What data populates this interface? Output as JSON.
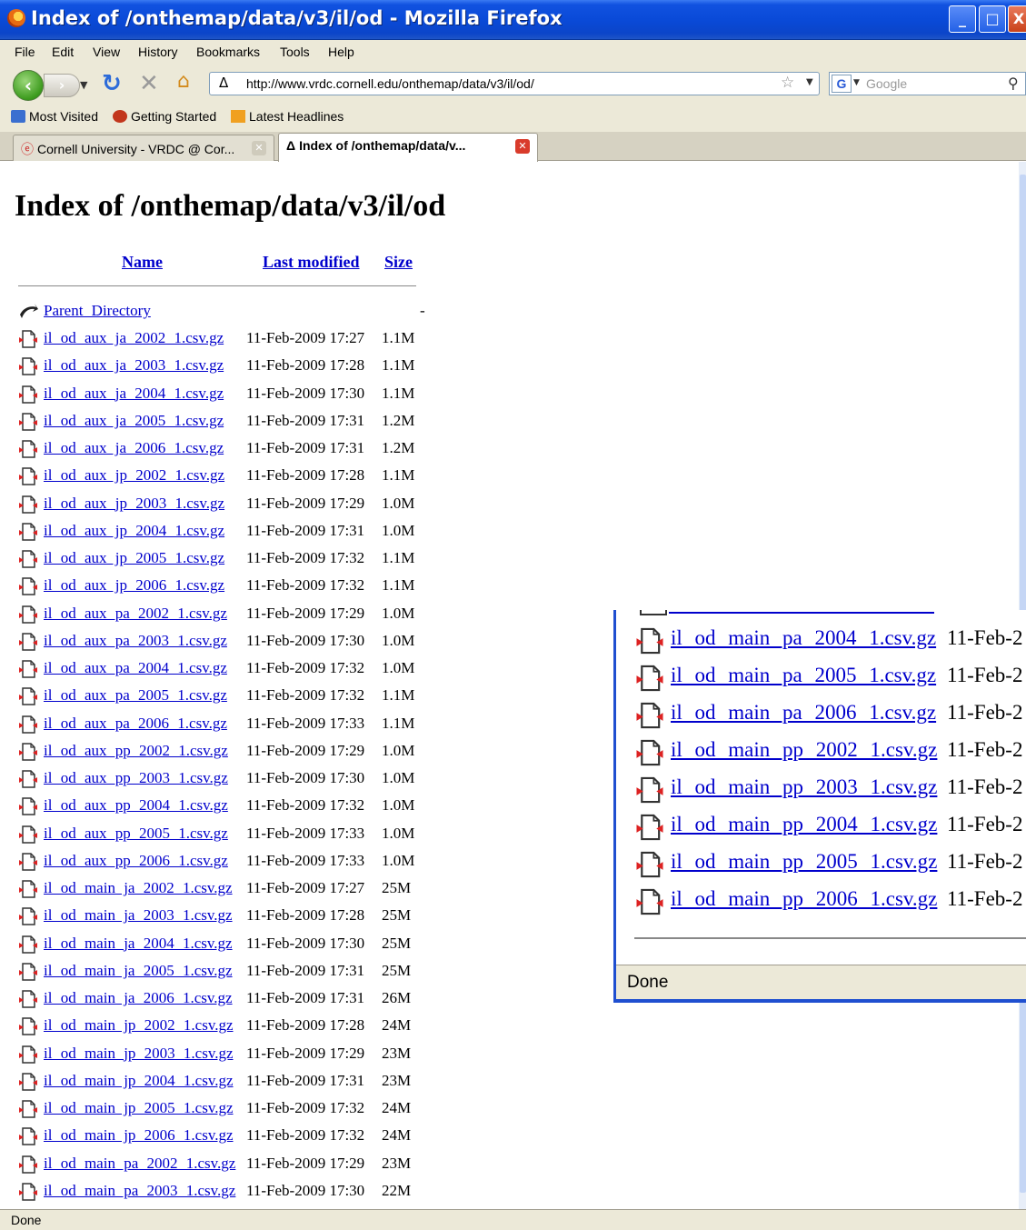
{
  "window": {
    "title": "Index of /onthemap/data/v3/il/od - Mozilla Firefox",
    "minimize": "_",
    "maximize": "□",
    "close": "X"
  },
  "menu": [
    "File",
    "Edit",
    "View",
    "History",
    "Bookmarks",
    "Tools",
    "Help"
  ],
  "nav": {
    "url": "http://www.vrdc.cornell.edu/onthemap/data/v3/il/od/",
    "search_placeholder": "Google",
    "search_engine_letter": "G"
  },
  "bookmarks": [
    "Most Visited",
    "Getting Started",
    "Latest Headlines"
  ],
  "tabs": [
    {
      "label": "Cornell University - VRDC @ Cor...",
      "active": false
    },
    {
      "label": "Index of /onthemap/data/v...",
      "active": true
    }
  ],
  "page": {
    "title": "Index of /onthemap/data/v3/il/od",
    "columns": {
      "name": "Name",
      "modified": "Last modified",
      "size": "Size"
    },
    "parent": {
      "name": "Parent Directory",
      "size": "-"
    },
    "files": [
      {
        "name": "il_od_aux_ja_2002_1.csv.gz",
        "modified": "11-Feb-2009 17:27",
        "size": "1.1M"
      },
      {
        "name": "il_od_aux_ja_2003_1.csv.gz",
        "modified": "11-Feb-2009 17:28",
        "size": "1.1M"
      },
      {
        "name": "il_od_aux_ja_2004_1.csv.gz",
        "modified": "11-Feb-2009 17:30",
        "size": "1.1M"
      },
      {
        "name": "il_od_aux_ja_2005_1.csv.gz",
        "modified": "11-Feb-2009 17:31",
        "size": "1.2M"
      },
      {
        "name": "il_od_aux_ja_2006_1.csv.gz",
        "modified": "11-Feb-2009 17:31",
        "size": "1.2M"
      },
      {
        "name": "il_od_aux_jp_2002_1.csv.gz",
        "modified": "11-Feb-2009 17:28",
        "size": "1.1M"
      },
      {
        "name": "il_od_aux_jp_2003_1.csv.gz",
        "modified": "11-Feb-2009 17:29",
        "size": "1.0M"
      },
      {
        "name": "il_od_aux_jp_2004_1.csv.gz",
        "modified": "11-Feb-2009 17:31",
        "size": "1.0M"
      },
      {
        "name": "il_od_aux_jp_2005_1.csv.gz",
        "modified": "11-Feb-2009 17:32",
        "size": "1.1M"
      },
      {
        "name": "il_od_aux_jp_2006_1.csv.gz",
        "modified": "11-Feb-2009 17:32",
        "size": "1.1M"
      },
      {
        "name": "il_od_aux_pa_2002_1.csv.gz",
        "modified": "11-Feb-2009 17:29",
        "size": "1.0M"
      },
      {
        "name": "il_od_aux_pa_2003_1.csv.gz",
        "modified": "11-Feb-2009 17:30",
        "size": "1.0M"
      },
      {
        "name": "il_od_aux_pa_2004_1.csv.gz",
        "modified": "11-Feb-2009 17:32",
        "size": "1.0M"
      },
      {
        "name": "il_od_aux_pa_2005_1.csv.gz",
        "modified": "11-Feb-2009 17:32",
        "size": "1.1M"
      },
      {
        "name": "il_od_aux_pa_2006_1.csv.gz",
        "modified": "11-Feb-2009 17:33",
        "size": "1.1M"
      },
      {
        "name": "il_od_aux_pp_2002_1.csv.gz",
        "modified": "11-Feb-2009 17:29",
        "size": "1.0M"
      },
      {
        "name": "il_od_aux_pp_2003_1.csv.gz",
        "modified": "11-Feb-2009 17:30",
        "size": "1.0M"
      },
      {
        "name": "il_od_aux_pp_2004_1.csv.gz",
        "modified": "11-Feb-2009 17:32",
        "size": "1.0M"
      },
      {
        "name": "il_od_aux_pp_2005_1.csv.gz",
        "modified": "11-Feb-2009 17:33",
        "size": "1.0M"
      },
      {
        "name": "il_od_aux_pp_2006_1.csv.gz",
        "modified": "11-Feb-2009 17:33",
        "size": "1.0M"
      },
      {
        "name": "il_od_main_ja_2002_1.csv.gz",
        "modified": "11-Feb-2009 17:27",
        "size": "25M"
      },
      {
        "name": "il_od_main_ja_2003_1.csv.gz",
        "modified": "11-Feb-2009 17:28",
        "size": "25M"
      },
      {
        "name": "il_od_main_ja_2004_1.csv.gz",
        "modified": "11-Feb-2009 17:30",
        "size": "25M"
      },
      {
        "name": "il_od_main_ja_2005_1.csv.gz",
        "modified": "11-Feb-2009 17:31",
        "size": "25M"
      },
      {
        "name": "il_od_main_ja_2006_1.csv.gz",
        "modified": "11-Feb-2009 17:31",
        "size": "26M"
      },
      {
        "name": "il_od_main_jp_2002_1.csv.gz",
        "modified": "11-Feb-2009 17:28",
        "size": "24M"
      },
      {
        "name": "il_od_main_jp_2003_1.csv.gz",
        "modified": "11-Feb-2009 17:29",
        "size": "23M"
      },
      {
        "name": "il_od_main_jp_2004_1.csv.gz",
        "modified": "11-Feb-2009 17:31",
        "size": "23M"
      },
      {
        "name": "il_od_main_jp_2005_1.csv.gz",
        "modified": "11-Feb-2009 17:32",
        "size": "24M"
      },
      {
        "name": "il_od_main_jp_2006_1.csv.gz",
        "modified": "11-Feb-2009 17:32",
        "size": "24M"
      },
      {
        "name": "il_od_main_pa_2002_1.csv.gz",
        "modified": "11-Feb-2009 17:29",
        "size": "23M"
      },
      {
        "name": "il_od_main_pa_2003_1.csv.gz",
        "modified": "11-Feb-2009 17:30",
        "size": "22M"
      }
    ]
  },
  "zoom_inset": {
    "files": [
      {
        "name": "il_od_main_pa_2004_1.csv.gz",
        "modified": "11-Feb-2"
      },
      {
        "name": "il_od_main_pa_2005_1.csv.gz",
        "modified": "11-Feb-2"
      },
      {
        "name": "il_od_main_pa_2006_1.csv.gz",
        "modified": "11-Feb-2"
      },
      {
        "name": "il_od_main_pp_2002_1.csv.gz",
        "modified": "11-Feb-2"
      },
      {
        "name": "il_od_main_pp_2003_1.csv.gz",
        "modified": "11-Feb-2"
      },
      {
        "name": "il_od_main_pp_2004_1.csv.gz",
        "modified": "11-Feb-2"
      },
      {
        "name": "il_od_main_pp_2005_1.csv.gz",
        "modified": "11-Feb-2"
      },
      {
        "name": "il_od_main_pp_2006_1.csv.gz",
        "modified": "11-Feb-2"
      }
    ],
    "status": "Done"
  },
  "status": "Done",
  "colors": {
    "link": "#0000cc",
    "titlebar": "#0a4ad8",
    "chrome": "#ece9d8"
  }
}
